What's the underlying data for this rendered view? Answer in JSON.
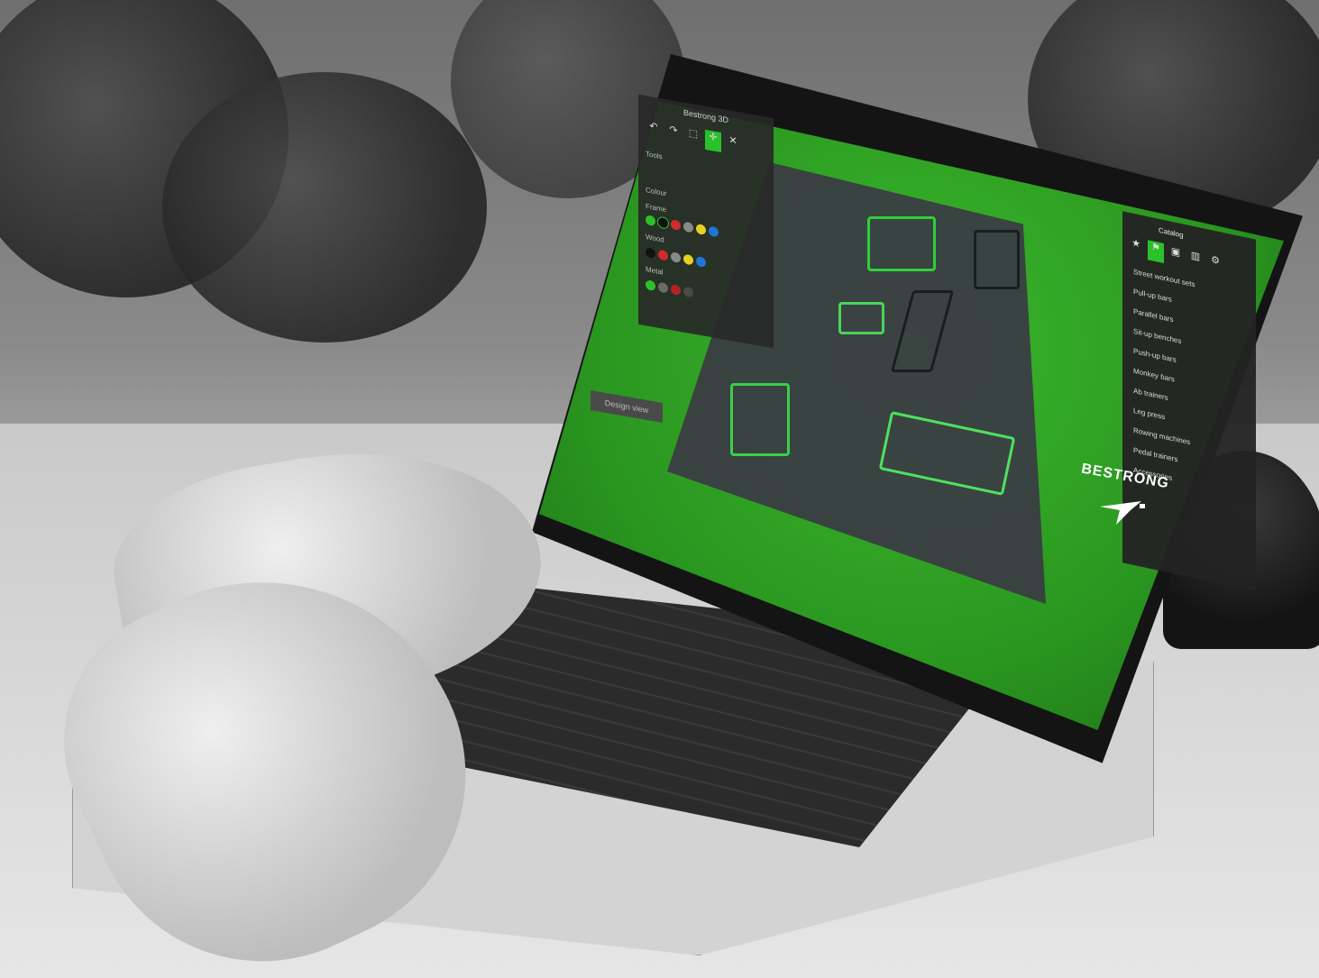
{
  "app": {
    "left_panel": {
      "title": "Bestrong 3D",
      "tools": [
        "↶",
        "↷",
        "⬚",
        "✛",
        "✕"
      ],
      "section_labels": [
        "Tools",
        "Colour",
        "Frame",
        "Wood",
        "Metal"
      ],
      "swatch_rows": [
        [
          "#2bc12a",
          "#111111",
          "#d12a2a",
          "#8a8a8a",
          "#e7d125",
          "#1f76d3"
        ],
        [
          "#111111",
          "#d12a2a",
          "#8a8a8a",
          "#e7d125",
          "#1f76d3"
        ],
        [
          "#2bc12a",
          "#6b6b6b",
          "#b52222",
          "#4a4a4a"
        ]
      ]
    },
    "design_label": "Design view",
    "right_panel": {
      "title": "Catalog",
      "tabs": [
        "★",
        "⚑",
        "▣",
        "▥",
        "⚙"
      ],
      "items": [
        "Street workout sets",
        "Pull-up bars",
        "Parallel bars",
        "Sit-up benches",
        "Push-up bars",
        "Monkey bars",
        "Ab trainers",
        "Leg press",
        "Rowing machines",
        "Pedal trainers",
        "Accessories"
      ]
    },
    "brand": {
      "name": "BESTRONG",
      "mark": "mark-icon"
    },
    "colors": {
      "grass": "#2fae22",
      "pavement": "#3a3d42",
      "panel": "#2b2b2b"
    }
  }
}
